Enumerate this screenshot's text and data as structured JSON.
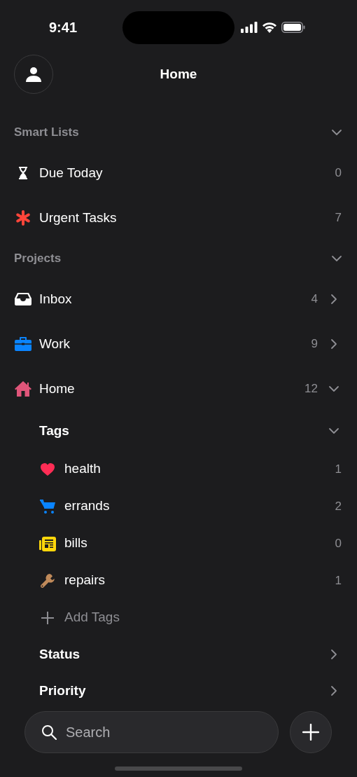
{
  "status_bar": {
    "time": "9:41"
  },
  "header": {
    "title": "Home"
  },
  "smart_lists": {
    "title": "Smart Lists",
    "expanded": true,
    "items": [
      {
        "name": "Due Today",
        "count": "0",
        "color": "#ffffff"
      },
      {
        "name": "Urgent Tasks",
        "count": "7",
        "color": "#ff453a"
      }
    ]
  },
  "projects": {
    "title": "Projects",
    "expanded": true,
    "items": [
      {
        "name": "Inbox",
        "count": "4",
        "color": "#ffffff",
        "expanded": false
      },
      {
        "name": "Work",
        "count": "9",
        "color": "#0a84ff",
        "expanded": false
      },
      {
        "name": "Home",
        "count": "12",
        "color": "#e0557a",
        "expanded": true,
        "children": [
          {
            "name": "Tags",
            "expanded": true,
            "add_label": "Add Tags",
            "tags": [
              {
                "name": "health",
                "count": "1",
                "color": "#ff2d55"
              },
              {
                "name": "errands",
                "count": "2",
                "color": "#0a84ff"
              },
              {
                "name": "bills",
                "count": "0",
                "color": "#ffd60a"
              },
              {
                "name": "repairs",
                "count": "1",
                "color": "#c08a5a"
              }
            ]
          },
          {
            "name": "Status",
            "expanded": false
          },
          {
            "name": "Priority",
            "expanded": false
          }
        ]
      }
    ]
  },
  "search": {
    "placeholder": "Search"
  }
}
